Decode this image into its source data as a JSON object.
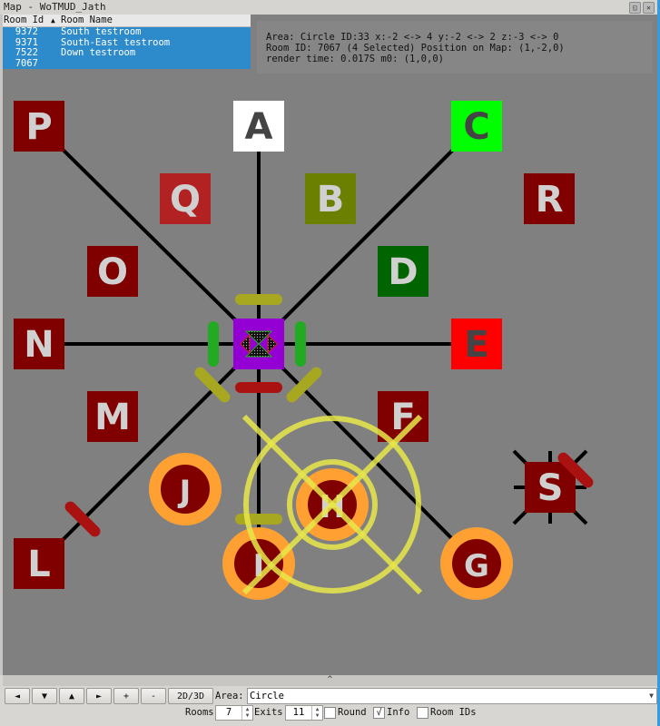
{
  "window": {
    "title": "Map - WoTMUD_Jath",
    "float_button": "float-icon",
    "close_button": "close-icon"
  },
  "room_table": {
    "columns": [
      "Room Id",
      "Room Name"
    ],
    "sort_indicator": "▲",
    "rows": [
      {
        "id": "9372",
        "name": "South testroom"
      },
      {
        "id": "9371",
        "name": "South-East testroom"
      },
      {
        "id": "7522",
        "name": "Down testroom"
      },
      {
        "id": "7067",
        "name": ""
      }
    ]
  },
  "info": {
    "line1": "Area: Circle ID:33 x:-2 <-> 4 y:-2 <-> 2 z:-3 <-> 0",
    "line2": "Room ID: 7067 (4 Selected) Position on Map: (1,-2,0)",
    "line3": "render time: 0.017S m0: (1,0,0)"
  },
  "rooms": [
    {
      "label": "P",
      "shape": "square",
      "fill": "#800000",
      "text": "#d0d0d0"
    },
    {
      "label": "A",
      "shape": "square",
      "fill": "#ffffff",
      "text": "#444444"
    },
    {
      "label": "C",
      "shape": "square",
      "fill": "#00ff00",
      "text": "#444444"
    },
    {
      "label": "Q",
      "shape": "square",
      "fill": "#b22222",
      "text": "#d0d0d0"
    },
    {
      "label": "B",
      "shape": "square",
      "fill": "#6b8000",
      "text": "#d0d0d0"
    },
    {
      "label": "R",
      "shape": "square",
      "fill": "#800000",
      "text": "#d0d0d0"
    },
    {
      "label": "O",
      "shape": "square",
      "fill": "#800000",
      "text": "#d0d0d0"
    },
    {
      "label": "D",
      "shape": "square",
      "fill": "#006400",
      "text": "#d0d0d0"
    },
    {
      "label": "N",
      "shape": "square",
      "fill": "#800000",
      "text": "#d0d0d0"
    },
    {
      "label": "",
      "shape": "square",
      "fill": "#9400d3",
      "text": "#d0d0d0"
    },
    {
      "label": "E",
      "shape": "square",
      "fill": "#ff0000",
      "text": "#444444"
    },
    {
      "label": "M",
      "shape": "square",
      "fill": "#800000",
      "text": "#d0d0d0"
    },
    {
      "label": "F",
      "shape": "square",
      "fill": "#800000",
      "text": "#d0d0d0"
    },
    {
      "label": "J",
      "shape": "circle",
      "fill": "#800000",
      "text": "#d0d0d0"
    },
    {
      "label": "H",
      "shape": "circle",
      "fill": "#800000",
      "text": "#d0d0d0"
    },
    {
      "label": "S",
      "shape": "square",
      "fill": "#800000",
      "text": "#d0d0d0"
    },
    {
      "label": "L",
      "shape": "square",
      "fill": "#800000",
      "text": "#d0d0d0"
    },
    {
      "label": "I",
      "shape": "circle",
      "fill": "#800000",
      "text": "#d0d0d0"
    },
    {
      "label": "G",
      "shape": "circle",
      "fill": "#800000",
      "text": "#d0d0d0"
    }
  ],
  "colors": {
    "map_bg": "#808080",
    "highlight_ring": "#ffa033",
    "selection": "#e8e84a",
    "exit_line": "#000000",
    "door_green": "#22aa22",
    "door_yellow": "#a8a820",
    "door_red": "#aa1111",
    "selected_row": "#2e8bcb"
  },
  "splitter": {
    "glyph": "^"
  },
  "toolbar": {
    "buttons": [
      "◄",
      "▼",
      "▲",
      "►",
      "+",
      "-",
      "2D/3D"
    ],
    "area_label": "Area:",
    "area_value": "Circle",
    "rooms_label": "Rooms",
    "rooms_value": "7",
    "exits_label": "Exits",
    "exits_value": "11",
    "round_label": "Round",
    "round_checked": false,
    "info_label": "Info",
    "info_checked": true,
    "roomids_label": "Room IDs",
    "roomids_checked": false
  }
}
